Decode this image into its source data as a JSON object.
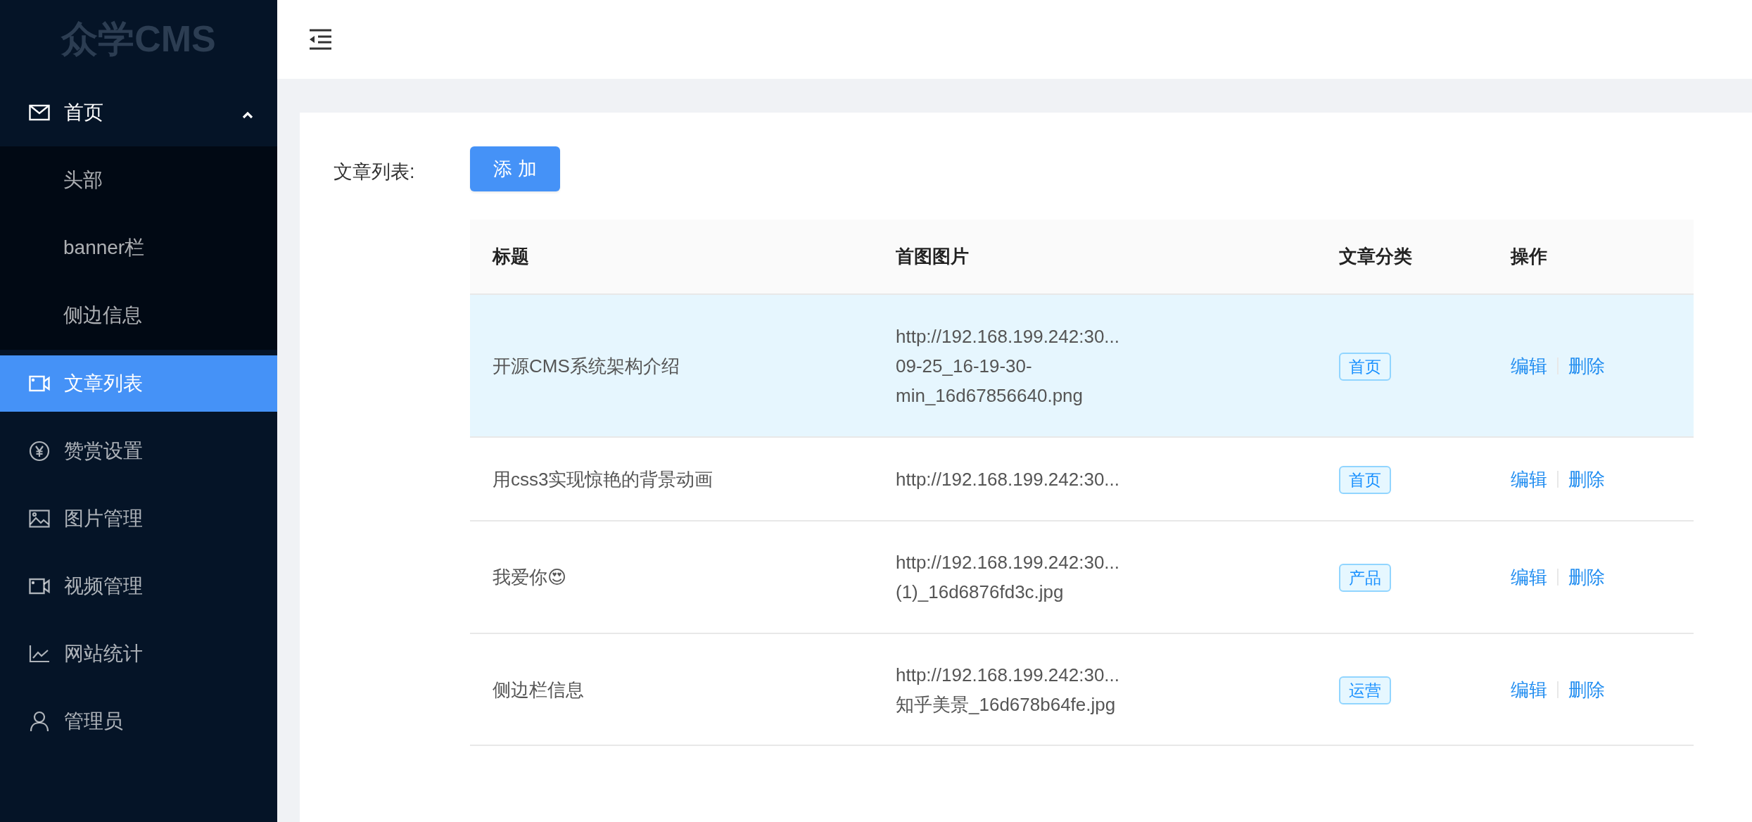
{
  "sidebar": {
    "logo": "众学CMS",
    "items": [
      {
        "label": "首页",
        "selected": false,
        "expanded": true,
        "children": [
          {
            "label": "头部",
            "selected": false
          },
          {
            "label": "banner栏",
            "selected": false
          },
          {
            "label": "侧边信息",
            "selected": false
          }
        ]
      },
      {
        "label": "文章列表",
        "selected": true
      },
      {
        "label": "赞赏设置",
        "selected": false
      },
      {
        "label": "图片管理",
        "selected": false
      },
      {
        "label": "视频管理",
        "selected": false
      },
      {
        "label": "网站统计",
        "selected": false
      },
      {
        "label": "管理员",
        "selected": false
      }
    ]
  },
  "content": {
    "label": "文章列表:",
    "add_button": "添 加",
    "table": {
      "columns": [
        "标题",
        "首图图片",
        "文章分类",
        "操作"
      ],
      "rows": [
        {
          "title": "开源CMS系统架构介绍",
          "image": "http://192.168.199.242:30...\n09-25_16-19-30-\nmin_16d67856640.png",
          "category": "首页",
          "actions": [
            "编辑",
            "删除"
          ],
          "highlighted": true
        },
        {
          "title": "用css3实现惊艳的背景动画",
          "image": "http://192.168.199.242:30...",
          "category": "首页",
          "actions": [
            "编辑",
            "删除"
          ],
          "highlighted": false
        },
        {
          "title": "我爱你😍",
          "image": "http://192.168.199.242:30...\n(1)_16d6876fd3c.jpg",
          "category": "产品",
          "actions": [
            "编辑",
            "删除"
          ],
          "highlighted": false
        },
        {
          "title": "侧边栏信息",
          "image": "http://192.168.199.242:30...\n知乎美景_16d678b64fe.jpg",
          "category": "运营",
          "actions": [
            "编辑",
            "删除"
          ],
          "highlighted": false
        }
      ]
    }
  }
}
